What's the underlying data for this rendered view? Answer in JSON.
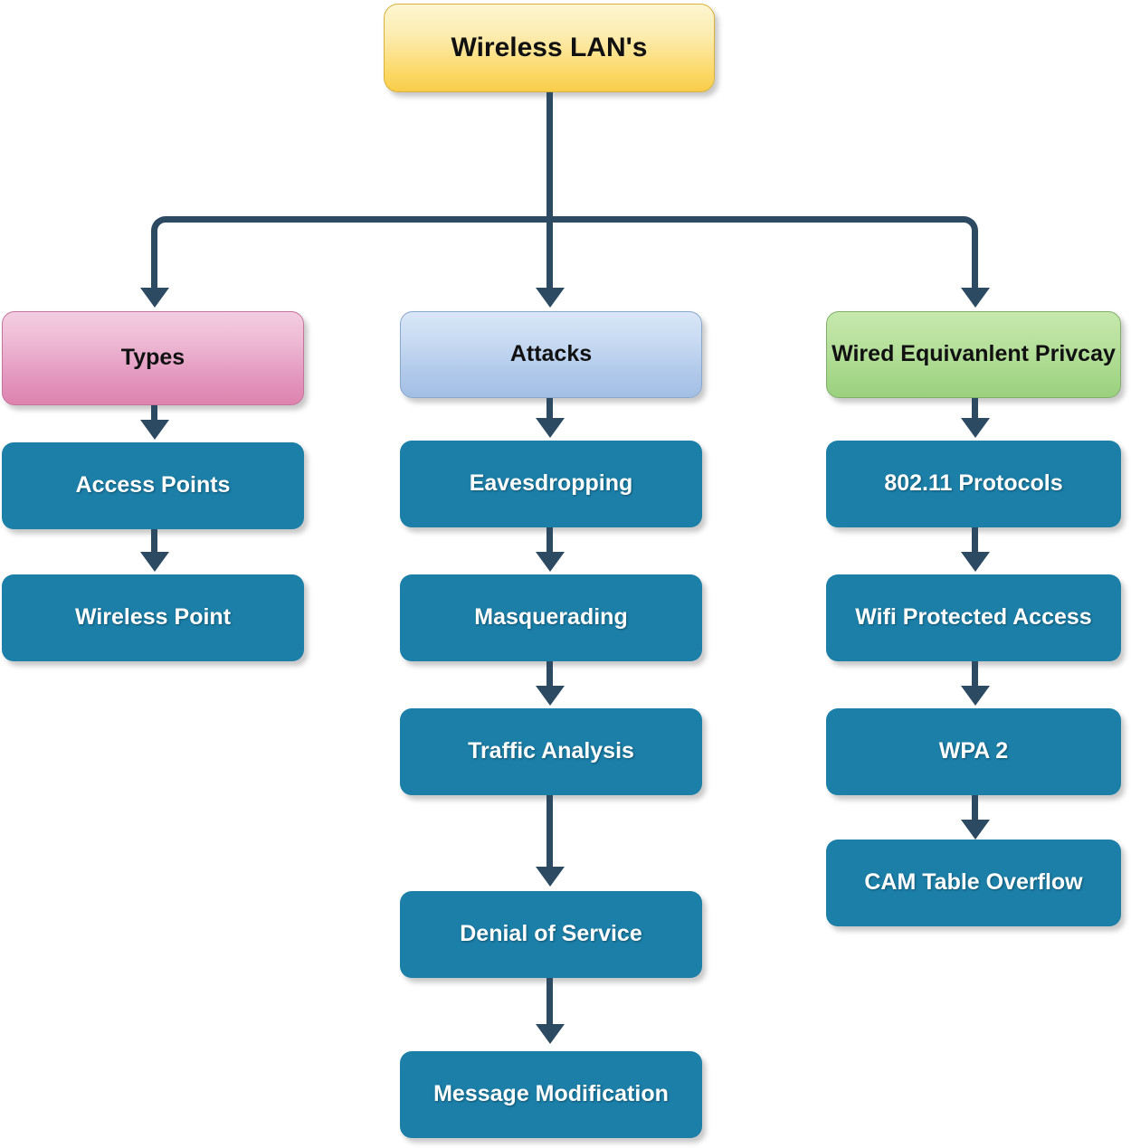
{
  "diagram": {
    "title_node": {
      "label": "Wireless LAN's",
      "color": "#fbd865"
    },
    "categories": [
      {
        "id": "types",
        "label": "Types",
        "color": "#e396be",
        "children": [
          {
            "label": "Access Points"
          },
          {
            "label": "Wireless Point"
          }
        ]
      },
      {
        "id": "attacks",
        "label": "Attacks",
        "color": "#b0c9ea",
        "children": [
          {
            "label": "Eavesdropping"
          },
          {
            "label": "Masquerading"
          },
          {
            "label": "Traffic Analysis"
          },
          {
            "label": "Denial of Service"
          },
          {
            "label": "Message Modification"
          }
        ]
      },
      {
        "id": "wep",
        "label": "Wired Equivanlent Privcay",
        "color": "#a7d88b",
        "children": [
          {
            "label": "802.11 Protocols"
          },
          {
            "label": "Wifi Protected Access"
          },
          {
            "label": "WPA 2"
          },
          {
            "label": "CAM Table Overflow"
          }
        ]
      }
    ],
    "leaf_color": "#1b7fa8",
    "connector_color": "#2d4a63"
  }
}
